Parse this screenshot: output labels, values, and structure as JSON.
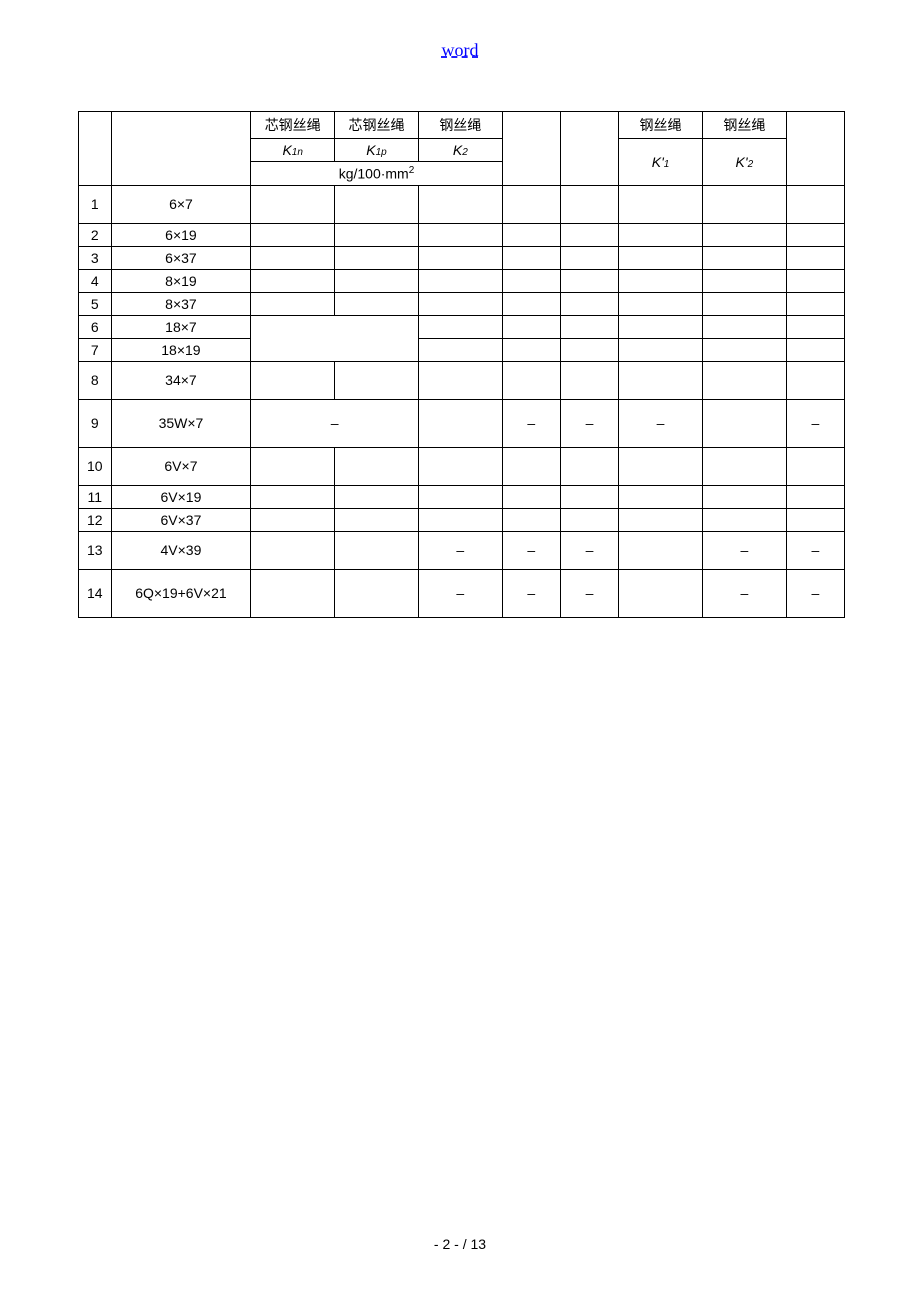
{
  "header": {
    "title": "word"
  },
  "table": {
    "head": {
      "r1c1": "芯钢丝绳",
      "r1c2": "芯钢丝绳",
      "r1c3": "钢丝绳",
      "r1c4": "钢丝绳",
      "r1c5": "钢丝绳",
      "r2c1_prefix": "K",
      "r2c1_sub": "1n",
      "r2c2_prefix": "K",
      "r2c2_sub": "1p",
      "r2c3_prefix": "K",
      "r2c3_sub": "2",
      "r3c1": "kg/100·mm",
      "r3c1_sup": "2",
      "r3c2_prefix": "K'",
      "r3c2_sub": "1",
      "r3c3_prefix": "K'",
      "r3c3_sub": "2"
    },
    "rows": [
      {
        "n": "1",
        "spec": "6×7",
        "v": [
          "",
          "",
          "",
          "",
          "",
          "",
          "",
          ""
        ],
        "tall": true
      },
      {
        "n": "2",
        "spec": "6×19",
        "v": [
          "",
          "",
          "",
          "",
          "",
          "",
          "",
          ""
        ]
      },
      {
        "n": "3",
        "spec": "6×37",
        "v": [
          "",
          "",
          "",
          "",
          "",
          "",
          "",
          ""
        ]
      },
      {
        "n": "4",
        "spec": "8×19",
        "v": [
          "",
          "",
          "",
          "",
          "",
          "",
          "",
          ""
        ]
      },
      {
        "n": "5",
        "spec": "8×37",
        "v": [
          "",
          "",
          "",
          "",
          "",
          "",
          "",
          ""
        ]
      },
      {
        "n": "6",
        "spec": "18×7",
        "merge67": true,
        "v": [
          "",
          "",
          "",
          "",
          "",
          "",
          "",
          ""
        ]
      },
      {
        "n": "7",
        "spec": "18×19",
        "v": [
          "",
          "",
          "",
          "",
          "",
          "",
          ""
        ]
      },
      {
        "n": "8",
        "spec": "34×7",
        "v": [
          "",
          "",
          "",
          "",
          "",
          "",
          "",
          ""
        ],
        "tall": true
      },
      {
        "n": "9",
        "spec": "35W×7",
        "merge12": true,
        "v": [
          "–",
          "",
          "–",
          "–",
          "–",
          "",
          "–"
        ],
        "taller": true
      },
      {
        "n": "10",
        "spec": "6V×7",
        "v": [
          "",
          "",
          "",
          "",
          "",
          "",
          "",
          ""
        ],
        "tall": true
      },
      {
        "n": "11",
        "spec": "6V×19",
        "v": [
          "",
          "",
          "",
          "",
          "",
          "",
          "",
          ""
        ]
      },
      {
        "n": "12",
        "spec": "6V×37",
        "v": [
          "",
          "",
          "",
          "",
          "",
          "",
          "",
          ""
        ]
      },
      {
        "n": "13",
        "spec": "4V×39",
        "v": [
          "",
          "",
          "–",
          "–",
          "–",
          "",
          "–",
          "–"
        ],
        "tall": true
      },
      {
        "n": "14",
        "spec": "6Q×19+6V×21",
        "v": [
          "",
          "",
          "–",
          "–",
          "–",
          "",
          "–",
          "–"
        ],
        "taller": true
      }
    ]
  },
  "footer": {
    "page": "- 2 -  / 13"
  }
}
